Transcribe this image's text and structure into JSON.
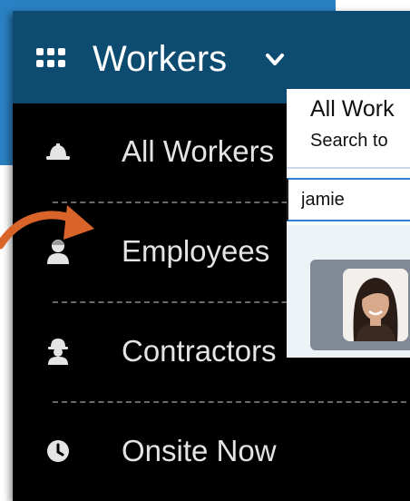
{
  "colors": {
    "header_bg": "#0d4b70",
    "menu_bg": "#000000",
    "backdrop_blue": "#2a80c2",
    "arrow": "#d9642a",
    "input_border": "#2c7fd1"
  },
  "header": {
    "title": "Workers",
    "icon": "apps-grid-icon",
    "dropdown_icon": "chevron-down-icon"
  },
  "menu": {
    "items": [
      {
        "label": "All Workers",
        "icon": "hard-hat-icon"
      },
      {
        "label": "Employees",
        "icon": "employee-icon"
      },
      {
        "label": "Contractors",
        "icon": "contractor-icon"
      },
      {
        "label": "Onsite Now",
        "icon": "clock-icon"
      }
    ]
  },
  "overlay": {
    "title": "All Work",
    "subtitle": "Search to",
    "search_value": "jamie",
    "result_avatar_icon": "person-photo"
  }
}
